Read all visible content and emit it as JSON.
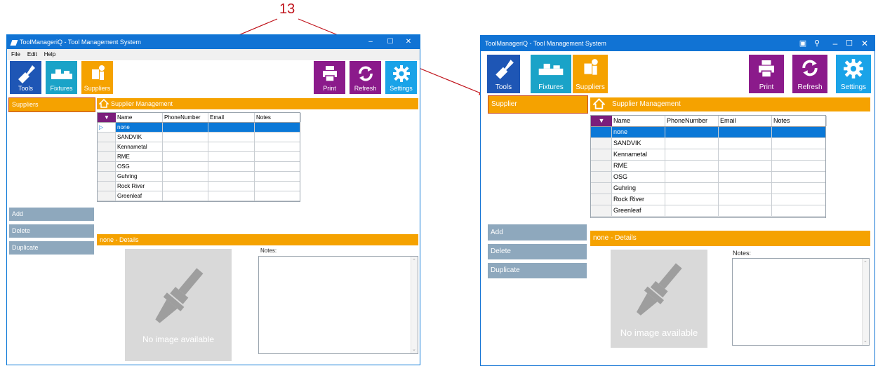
{
  "callout": {
    "number": "13",
    "color": "#c0141c"
  },
  "colors": {
    "titlebar": "#1173d4",
    "orange": "#f5a200",
    "purple": "#8b1a8b",
    "tools_blue": "#1e56b5",
    "fixtures_cyan": "#1aa3c8",
    "settings_blue": "#1aa3e8",
    "side_btn": "#8ea8bd",
    "selected_row": "#0a78d7"
  },
  "left": {
    "title": "ToolManageriQ - Tool Management System",
    "window_controls": [
      "–",
      "☐",
      "✕"
    ],
    "menu": [
      "File",
      "Edit",
      "Help"
    ],
    "tiles": {
      "tools": "Tools",
      "fixtures": "Fixtures",
      "suppliers": "Suppliers",
      "print": "Print",
      "refresh": "Refresh",
      "settings": "Settings"
    },
    "nav_item": "Suppliers",
    "section_title": "Supplier Management",
    "columns": [
      "Name",
      "PhoneNumber",
      "Email",
      "Notes"
    ],
    "rows": [
      "none",
      "SANDVIK",
      "Kennametal",
      "RME",
      "OSG",
      "Guhring",
      "Rock River",
      "Greenleaf"
    ],
    "selected_row_marker": "▷",
    "buttons": {
      "add": "Add",
      "delete": "Delete",
      "duplicate": "Duplicate"
    },
    "details_title": "none - Details",
    "notes_label": "Notes:",
    "no_image": "No image available",
    "scroll_up": "⌃",
    "scroll_down": "⌄"
  },
  "right": {
    "title": "ToolManageriQ - Tool Management System",
    "window_controls": [
      "–",
      "☐",
      "✕"
    ],
    "tiles": {
      "tools": "Tools",
      "fixtures": "Fixtures",
      "suppliers": "Suppliers",
      "print": "Print",
      "refresh": "Refresh",
      "settings": "Settings"
    },
    "nav_item": "Supplier",
    "section_title": "Supplier Management",
    "columns": [
      "Name",
      "PhoneNumber",
      "Email",
      "Notes"
    ],
    "rows": [
      "none",
      "SANDVIK",
      "Kennametal",
      "RME",
      "OSG",
      "Guhring",
      "Rock River",
      "Greenleaf"
    ],
    "buttons": {
      "add": "Add",
      "delete": "Delete",
      "duplicate": "Duplicate"
    },
    "details_title": "none - Details",
    "notes_label": "Notes:",
    "no_image": "No image available",
    "scroll_up": "⌃",
    "scroll_down": "⌄"
  }
}
